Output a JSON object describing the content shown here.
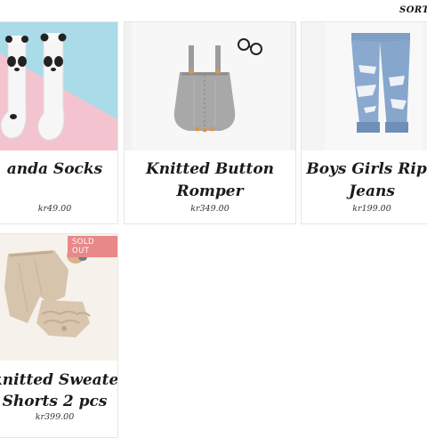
{
  "header": {
    "sort_label": "SORTE"
  },
  "products": [
    {
      "title_lines": [
        "anda Socks"
      ],
      "price": "kr49.00"
    },
    {
      "title_lines": [
        "Knitted Button",
        "Romper"
      ],
      "price": "kr349.00"
    },
    {
      "title_lines": [
        "Boys Girls Ripp",
        "Jeans"
      ],
      "price": "kr199.00"
    },
    {
      "title_lines": [
        "knitted Sweater",
        "Shorts 2 pcs"
      ],
      "price": "kr399.00",
      "badge": "SOLD OUT"
    }
  ],
  "colors": {
    "badge_bg": "#e88888",
    "card_border": "#e6e6e6",
    "title_text": "#1b1b1b"
  }
}
